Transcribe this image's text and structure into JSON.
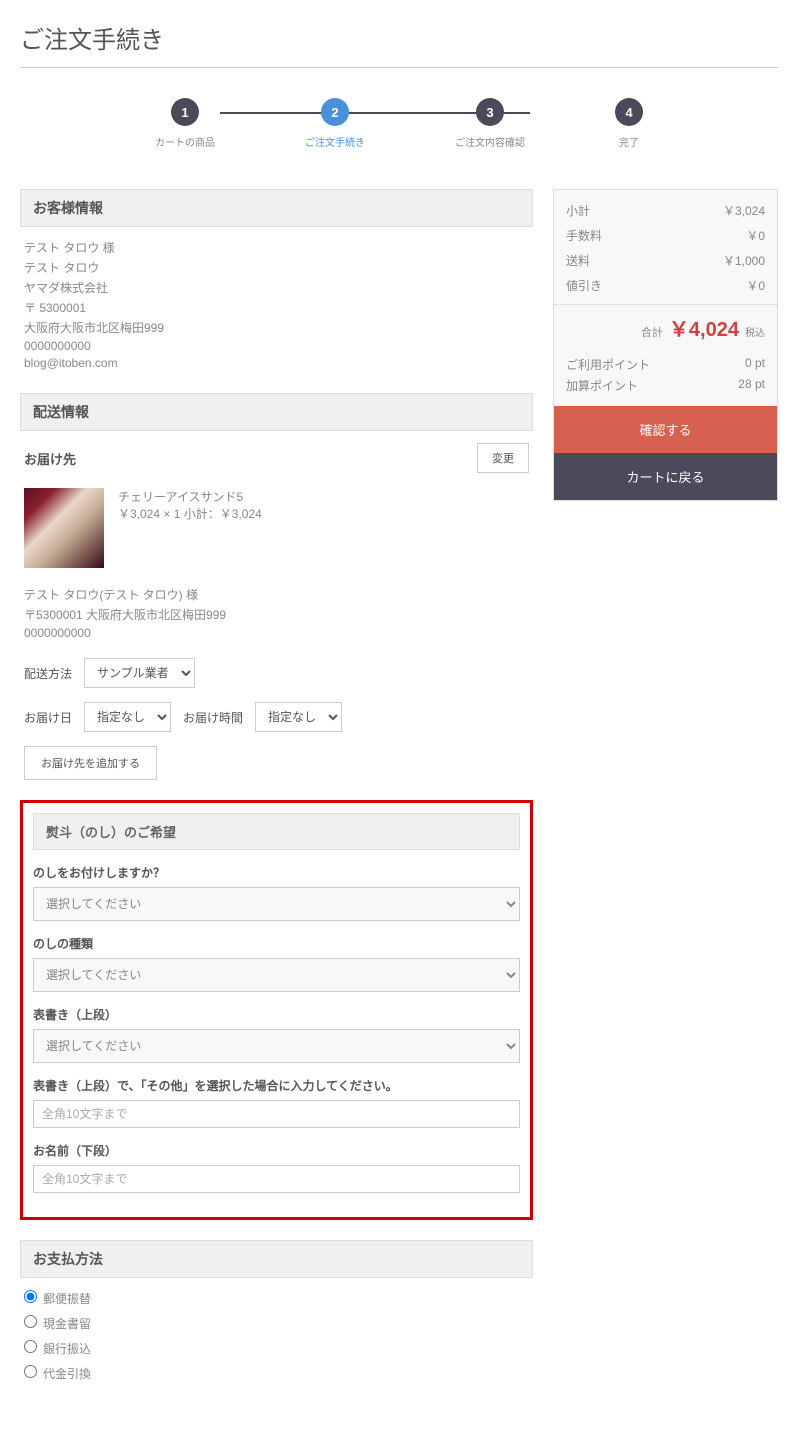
{
  "page_title": "ご注文手続き",
  "stepper": {
    "steps": [
      {
        "num": "1",
        "label": "カートの商品"
      },
      {
        "num": "2",
        "label": "ご注文手続き"
      },
      {
        "num": "3",
        "label": "ご注文内容確認"
      },
      {
        "num": "4",
        "label": "完了"
      }
    ],
    "active_index": 1
  },
  "customer": {
    "header": "お客様情報",
    "lines": [
      "テスト タロウ 様",
      "テスト タロウ",
      "ヤマダ株式会社",
      "〒 5300001",
      "大阪府大阪市北区梅田999",
      "0000000000",
      "blog@itoben.com"
    ]
  },
  "delivery": {
    "header": "配送情報",
    "dest_label": "お届け先",
    "change_btn": "変更",
    "product": {
      "name": "チェリーアイスサンド5",
      "detail": "￥3,024 × 1 小計：￥3,024"
    },
    "addr_lines": [
      "テスト タロウ(テスト タロウ) 様",
      "〒5300001 大阪府大阪市北区梅田999",
      "0000000000"
    ],
    "method_label": "配送方法",
    "method_value": "サンプル業者",
    "date_label": "お届け日",
    "date_value": "指定なし",
    "time_label": "お届け時間",
    "time_value": "指定なし",
    "add_btn": "お届け先を追加する"
  },
  "noshi": {
    "header": "熨斗（のし）のご希望",
    "q1_label": "のしをお付けしますか？",
    "q1_placeholder": "選択してください",
    "q2_label": "のしの種類",
    "q2_placeholder": "選択してください",
    "q3_label": "表書き（上段）",
    "q3_placeholder": "選択してください",
    "q4_label": "表書き（上段）で、「その他」を選択した場合に入力してください。",
    "q4_placeholder": "全角10文字まで",
    "q5_label": "お名前（下段）",
    "q5_placeholder": "全角10文字まで"
  },
  "payment": {
    "header": "お支払方法",
    "options": [
      "郵便振替",
      "現金書留",
      "銀行振込",
      "代金引換"
    ]
  },
  "summary": {
    "rows": [
      {
        "label": "小計",
        "value": "￥3,024"
      },
      {
        "label": "手数料",
        "value": "￥0"
      },
      {
        "label": "送料",
        "value": "￥1,000"
      },
      {
        "label": "値引き",
        "value": "￥0"
      }
    ],
    "total_label": "合計",
    "total_value": "￥4,024",
    "total_tax": "税込",
    "points": [
      {
        "label": "ご利用ポイント",
        "value": "0 pt"
      },
      {
        "label": "加算ポイント",
        "value": "28 pt"
      }
    ],
    "confirm_btn": "確認する",
    "back_btn": "カートに戻る"
  }
}
